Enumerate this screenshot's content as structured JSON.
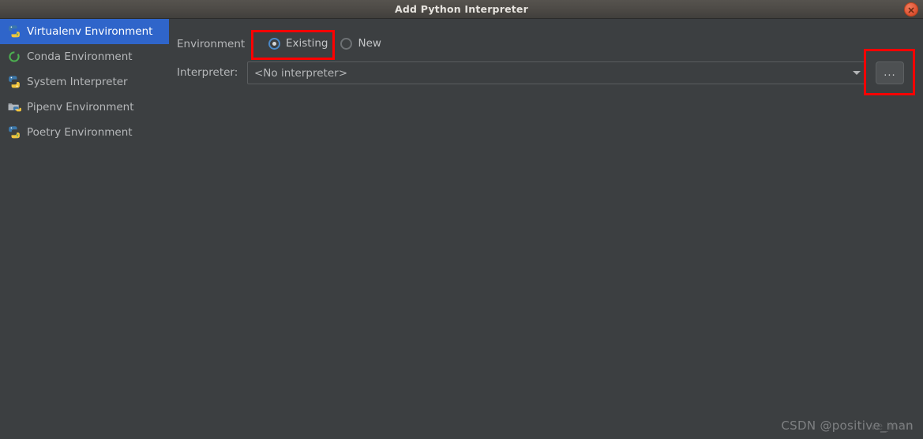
{
  "window": {
    "title": "Add Python Interpreter",
    "close_icon": "close-icon"
  },
  "sidebar": {
    "items": [
      {
        "label": "Virtualenv Environment",
        "icon": "python-virtualenv-icon",
        "selected": true
      },
      {
        "label": "Conda Environment",
        "icon": "conda-ring-icon",
        "selected": false
      },
      {
        "label": "System Interpreter",
        "icon": "python-icon",
        "selected": false
      },
      {
        "label": "Pipenv Environment",
        "icon": "folder-python-icon",
        "selected": false
      },
      {
        "label": "Poetry Environment",
        "icon": "python-virtualenv-icon",
        "selected": false
      }
    ]
  },
  "form": {
    "environment_label": "Environment",
    "interpreter_label": "Interpreter:",
    "radios": [
      {
        "label": "Existing",
        "selected": true
      },
      {
        "label": "New",
        "selected": false
      }
    ],
    "interpreter_value": "<No interpreter>",
    "interpreter_placeholder": "<No interpreter>",
    "dropdown_icon": "chevron-down-icon",
    "browse_button_label": "...",
    "browse_button_icon": "ellipsis-icon"
  },
  "annotations": {
    "highlight_existing": "existing-radio-highlight",
    "highlight_browse": "browse-button-highlight",
    "highlight_color": "#ff0000"
  },
  "watermark": {
    "text": "CSDN @positive_man",
    "ghost_text": "ve_man"
  },
  "colors": {
    "background": "#3c3f41",
    "selection": "#2f65ca",
    "text": "#b6b8ba",
    "accent": "#4a88c7",
    "titlebar": "#4e4b47",
    "close": "#e2593a"
  }
}
